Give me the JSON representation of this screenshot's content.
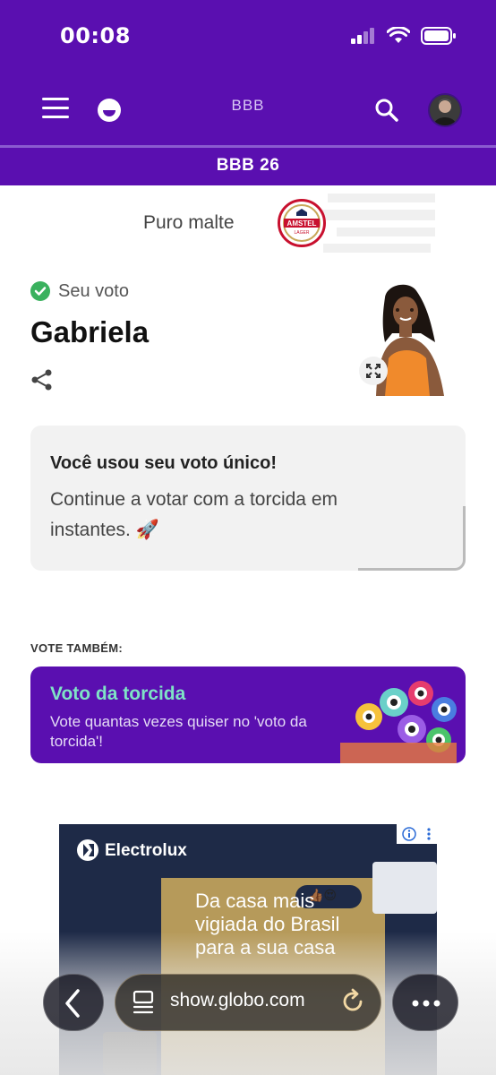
{
  "status_bar": {
    "time": "00:08"
  },
  "header": {
    "title": "BBB"
  },
  "subheader": {
    "title": "BBB 26"
  },
  "sponsor": {
    "text": "Puro malte",
    "logo_text": "AMSTEL",
    "logo_sub": "LAGER"
  },
  "vote": {
    "status_label": "Seu voto",
    "candidate_name": "Gabriela"
  },
  "notice": {
    "title": "Você usou seu voto único!",
    "text": "Continue a votar com a torcida em instantes. 🚀"
  },
  "vote_also": {
    "heading": "VOTE TAMBÉM:",
    "card_title": "Voto da torcida",
    "card_text": "Vote quantas vezes quiser no 'voto da torcida'!"
  },
  "ad": {
    "brand": "Electrolux",
    "headline": "Da casa mais vigiada do Brasil para a sua casa",
    "emojis": "👍🏾😍"
  },
  "browser": {
    "url": "show.globo.com"
  },
  "colors": {
    "brand_purple": "#5a0fb0",
    "accent_teal": "#7fe3c6",
    "check_green": "#3ab15e"
  }
}
